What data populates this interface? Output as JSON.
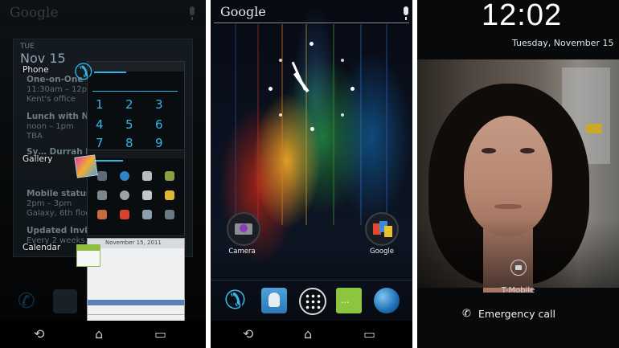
{
  "recent_apps": {
    "search_label": "Google",
    "calendar_widget": {
      "day": "TUE",
      "date": "Nov 15",
      "events": [
        {
          "title": "One-on-One w/…",
          "time": "11:30am – 12pm",
          "place": "Kent's office"
        },
        {
          "title": "Lunch with Nicol…",
          "time": "noon – 1pm",
          "place": "TBA"
        },
        {
          "title": "Sy… Durrah k…",
          "time": "",
          "place": ""
        },
        {
          "title": "Mobile status m…",
          "time": "2pm – 3pm",
          "place": "Galaxy, 6th floor"
        },
        {
          "title": "Updated Invitatio…",
          "time": "Every 2 weeks…",
          "place": ""
        }
      ]
    },
    "apps": [
      {
        "label": "Phone"
      },
      {
        "label": "Gallery"
      },
      {
        "label": "Calendar"
      }
    ],
    "dialer_keys": [
      "1",
      "2",
      "3",
      "4",
      "5",
      "6",
      "7",
      "8",
      "9"
    ],
    "calendar_thumb_title": "November 15, 2011"
  },
  "home_screen": {
    "search_label": "Google",
    "shortcuts": [
      {
        "label": "Camera",
        "icon": "camera-icon"
      },
      {
        "label": "Google",
        "icon": "google-folder-icon"
      }
    ],
    "dock": [
      {
        "icon": "phone-icon"
      },
      {
        "icon": "contacts-icon"
      },
      {
        "icon": "all-apps-icon"
      },
      {
        "icon": "messaging-icon"
      },
      {
        "icon": "browser-icon"
      }
    ]
  },
  "lock_screen": {
    "time": "12:02",
    "date": "Tuesday, November 15",
    "carrier": "T-Mobile",
    "emergency_label": "Emergency call"
  },
  "colors": {
    "holo_blue": "#33b5e5",
    "lock_text": "#e3e6e8"
  }
}
